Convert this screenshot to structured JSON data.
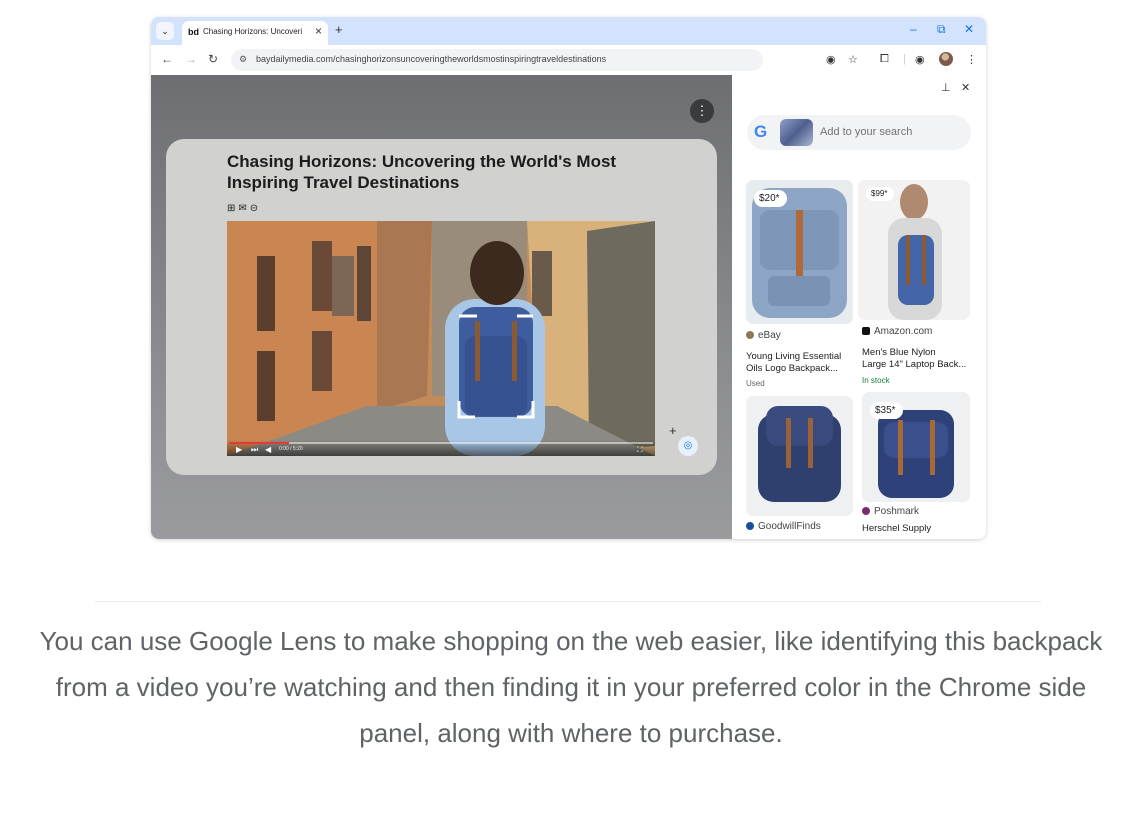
{
  "browser": {
    "tab_title": "Chasing Horizons: Uncoveri",
    "tab_favicon": "bd",
    "new_tab_label": "+",
    "minimize": "–",
    "restore": "⧉",
    "close": "✕",
    "site_info_icon": "tune-icon",
    "url": "baydailymedia.com/chasinghorizonsuncoveringtheworldsmostinspiringtraveldestinations",
    "accent_color": "#d3e3fd"
  },
  "page": {
    "article_title": "Chasing Horizons: Uncovering the World's Most Inspiring Travel Destinations",
    "share_icons": "⊞✉⊝",
    "video": {
      "time": "0:00 / 5:20"
    }
  },
  "side_panel": {
    "search_placeholder": "Add to your search",
    "results": [
      {
        "price": "$20*",
        "source": "eBay",
        "name_line1": "Young Living Essential",
        "name_line2": "Oils Logo Backpack...",
        "stock": "Used",
        "stock_color": "#5f6368"
      },
      {
        "price": "$99*",
        "source": "Amazon.com",
        "name_line1": "Men's Blue Nylon",
        "name_line2": "Large 14\" Laptop Back...",
        "stock": "In stock",
        "stock_color": "#188038"
      },
      {
        "source": "GoodwillFinds"
      },
      {
        "price": "$35*",
        "source": "Poshmark",
        "name_line1": "Herschel Supply"
      }
    ]
  },
  "caption": {
    "line1": "You can use Google Lens to make shopping on the web easier, like identifying this backpack",
    "line2": "from a video you’re watching and then finding it in your preferred color in the Chrome side",
    "line3": "panel, along with where to purchase."
  }
}
